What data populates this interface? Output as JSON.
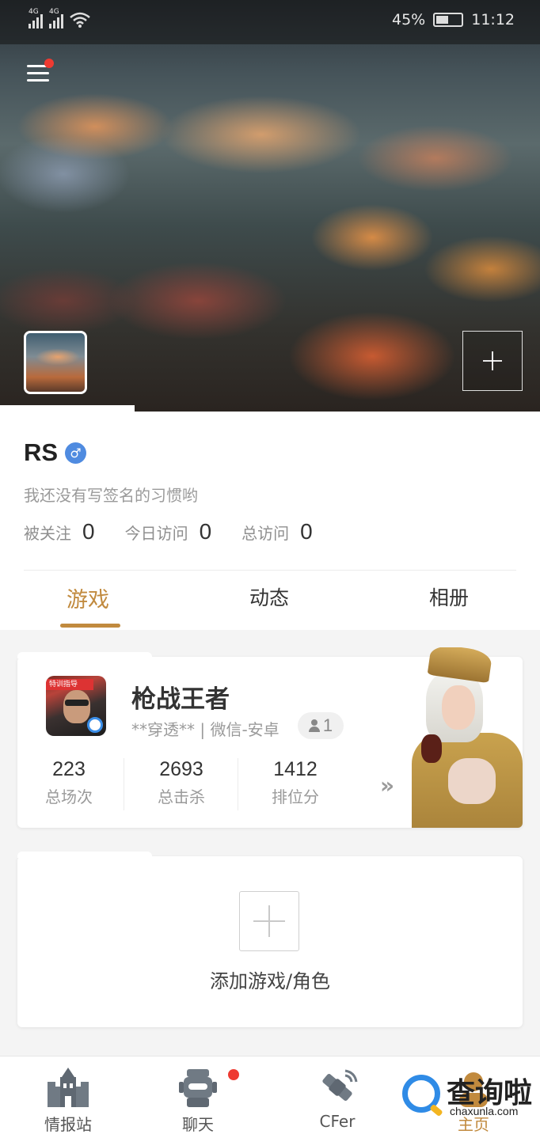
{
  "status_bar": {
    "network_1": "4G",
    "network_2": "4G",
    "battery": "45%",
    "time": "11:12"
  },
  "header": {
    "menu_has_notification": true,
    "add_cover_icon": "plus-icon"
  },
  "profile": {
    "name": "RS",
    "gender_symbol": "♂",
    "signature": "我还没有写签名的习惯哟",
    "stats": [
      {
        "label": "被关注",
        "value": "0"
      },
      {
        "label": "今日访问",
        "value": "0"
      },
      {
        "label": "总访问",
        "value": "0"
      }
    ]
  },
  "tabs": [
    {
      "label": "游戏",
      "active": true
    },
    {
      "label": "动态",
      "active": false
    },
    {
      "label": "相册",
      "active": false
    }
  ],
  "game_card": {
    "title": "枪战王者",
    "icon_banner": "特训指导",
    "meta": "**穿透** | 微信-安卓",
    "friends_count": "1",
    "stats": [
      {
        "value": "223",
        "label": "总场次"
      },
      {
        "value": "2693",
        "label": "总击杀"
      },
      {
        "value": "1412",
        "label": "排位分"
      }
    ],
    "more": "»"
  },
  "add_game": {
    "label": "添加游戏/角色"
  },
  "bottom_nav": [
    {
      "label": "情报站",
      "icon": "castle-icon",
      "badge": false
    },
    {
      "label": "聊天",
      "icon": "robot-chat-icon",
      "badge": true
    },
    {
      "label": "CFer",
      "icon": "satellite-icon",
      "badge": false
    },
    {
      "label": "主页",
      "icon": "profile-icon",
      "badge": false
    }
  ],
  "watermark": {
    "text": "查询啦",
    "url": "chaxunla.com"
  },
  "colors": {
    "accent": "#c18a3e",
    "badge_red": "#ee3a31",
    "gender_blue": "#4f8be0"
  }
}
